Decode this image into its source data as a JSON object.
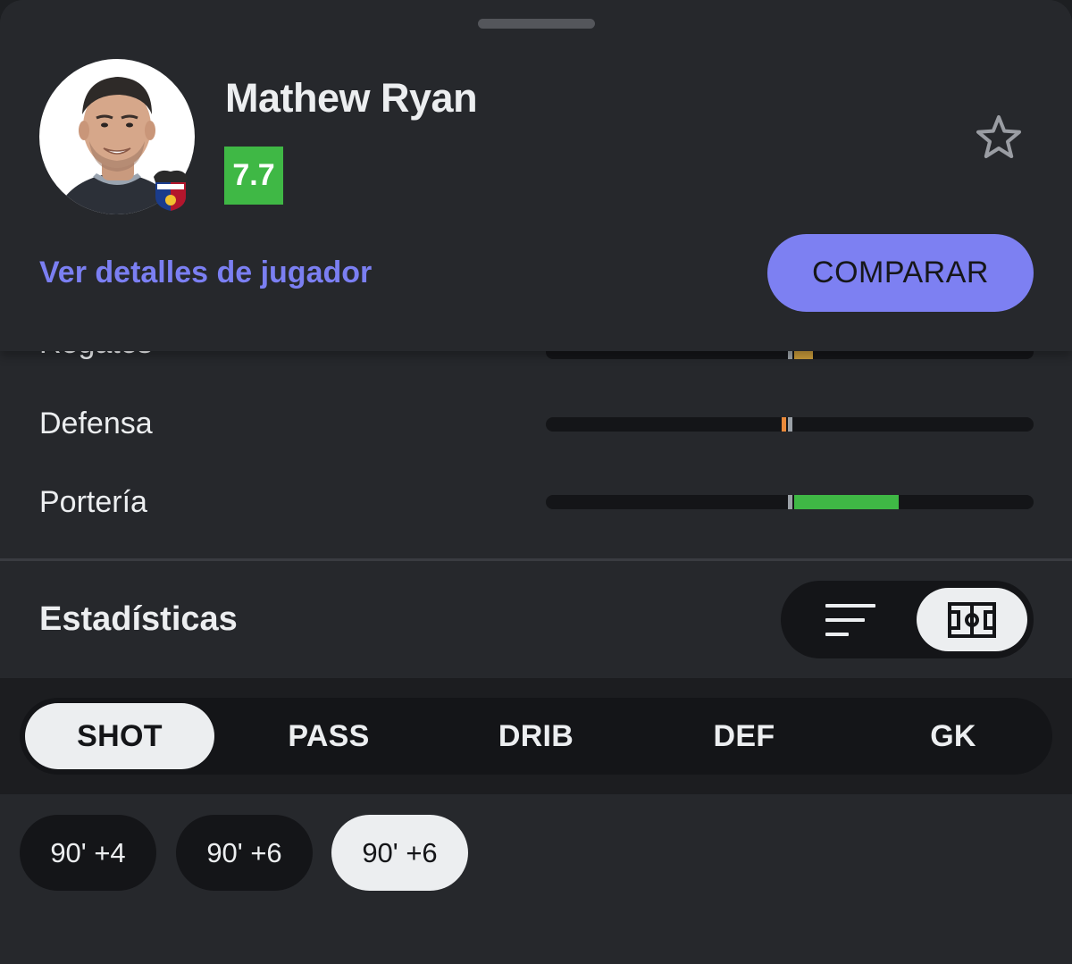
{
  "player": {
    "name": "Mathew Ryan",
    "rating": "7.7",
    "rating_color": "#3fb845",
    "club_badge": "levante-crest"
  },
  "actions": {
    "details_link": "Ver detalles de jugador",
    "compare_button": "COMPARAR",
    "favorite_icon": "star-outline-icon"
  },
  "attributes": [
    {
      "label": "Regates",
      "value": 0.08,
      "color": "#c79a3a"
    },
    {
      "label": "Defensa",
      "value": -0.02,
      "color": "#e8893a"
    },
    {
      "label": "Portería",
      "value": 0.43,
      "color": "#3fb845"
    }
  ],
  "stats": {
    "title": "Estadísticas",
    "view_toggle": {
      "options": [
        "list-icon",
        "pitch-icon"
      ],
      "selected": "pitch-icon"
    }
  },
  "tabs": {
    "items": [
      "SHOT",
      "PASS",
      "DRIB",
      "DEF",
      "GK"
    ],
    "active": "SHOT"
  },
  "periods": {
    "items": [
      "90' +4",
      "90' +6",
      "90' +6"
    ],
    "active_index": 2
  }
}
